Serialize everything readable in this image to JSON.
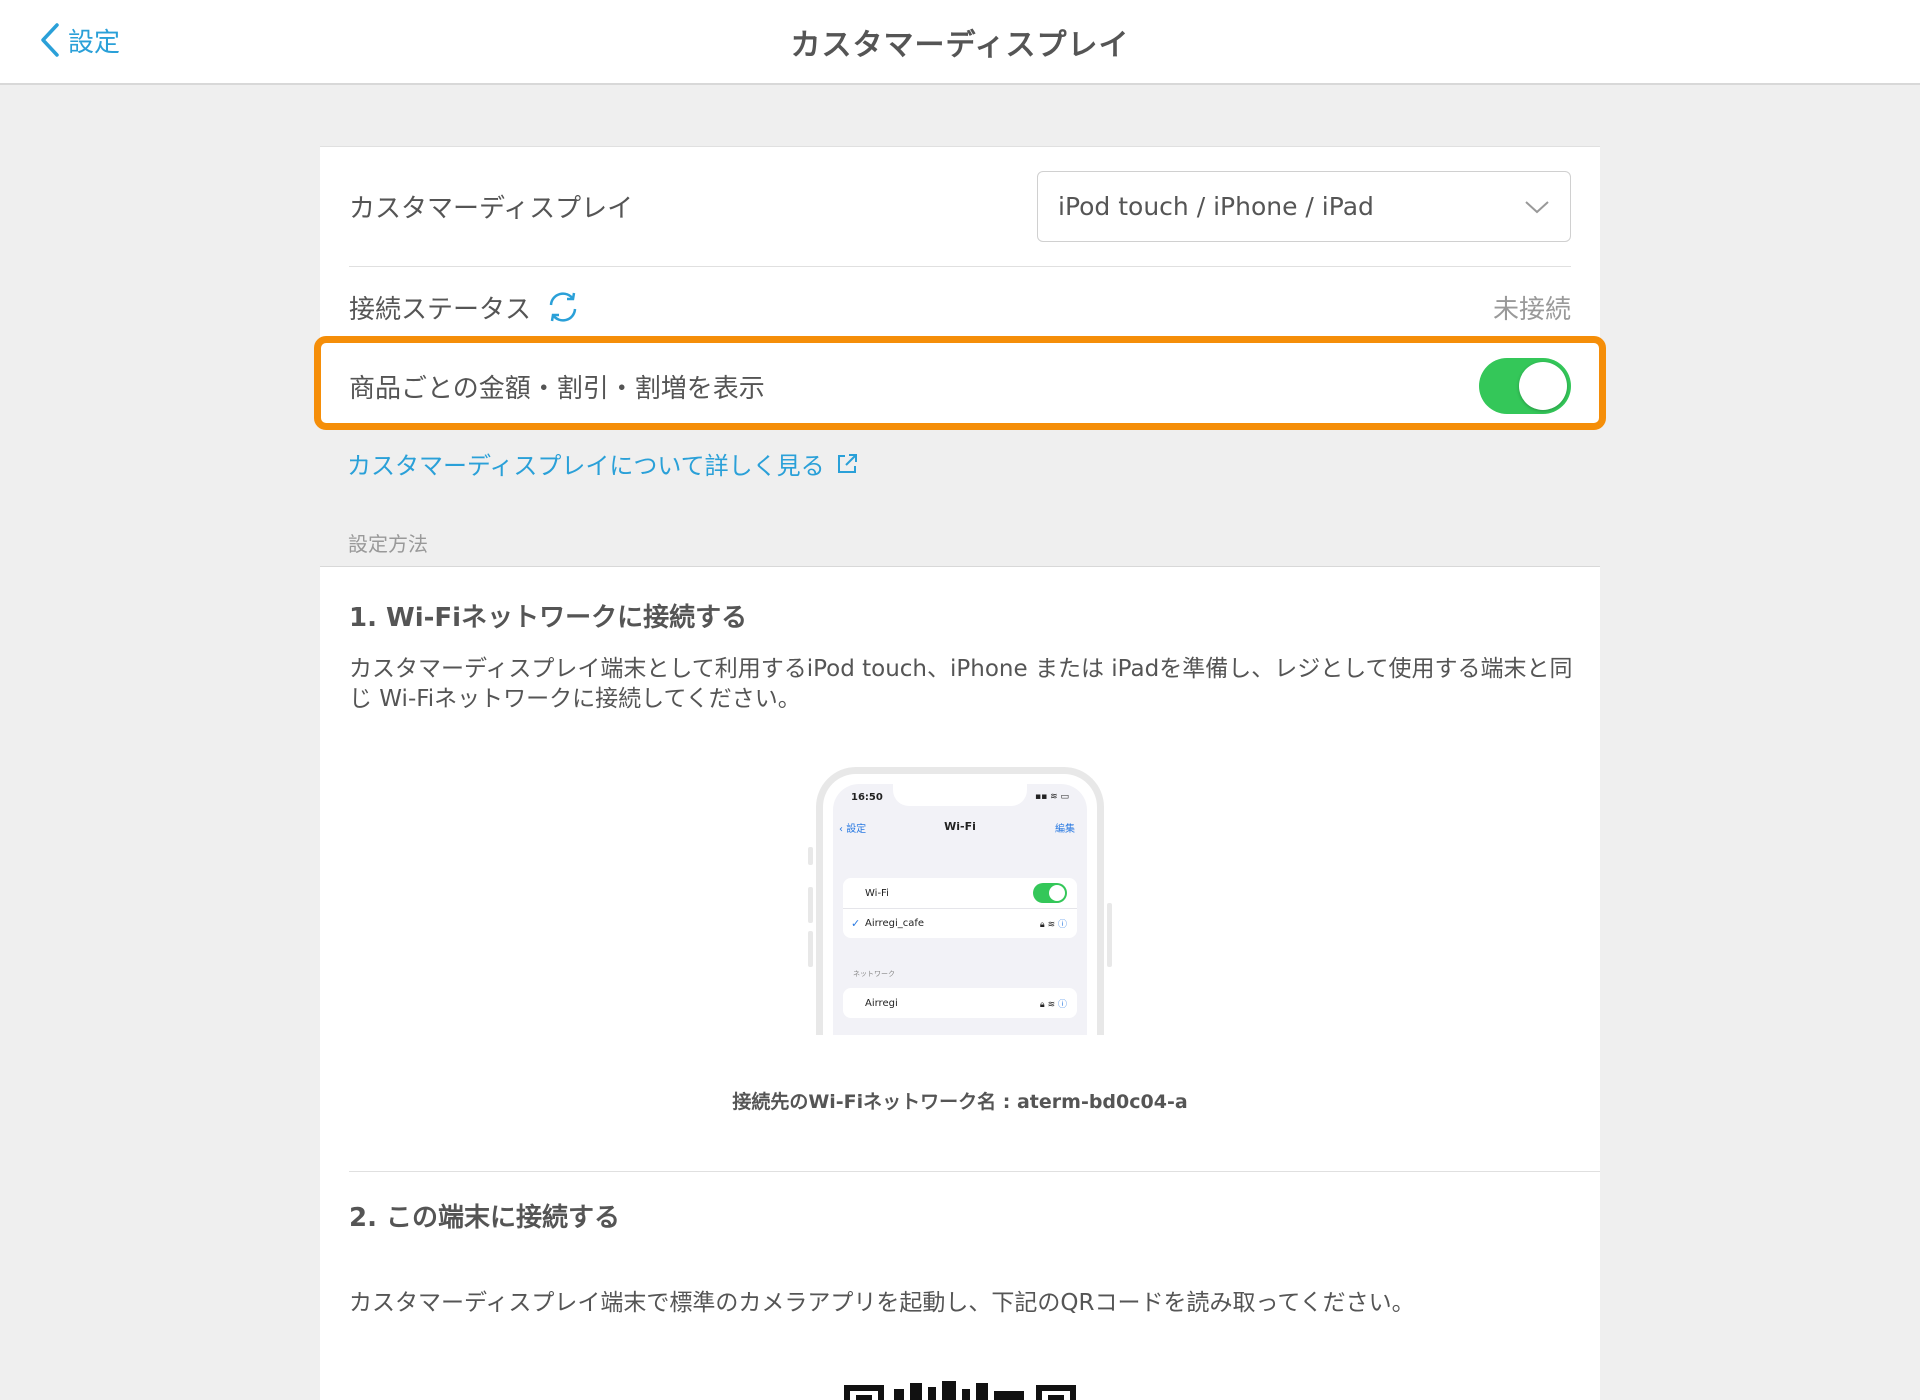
{
  "nav": {
    "back_label": "設定",
    "title": "カスタマーディスプレイ"
  },
  "settings": {
    "display_label": "カスタマーディスプレイ",
    "display_value": "iPod touch / iPhone / iPad",
    "status_label": "接続ステータス",
    "status_value": "未接続",
    "toggle_label": "商品ごとの金額・割引・割増を表示",
    "toggle_on": true,
    "learn_more_link": "カスタマーディスプレイについて詳しく見る"
  },
  "section_label": "設定方法",
  "step1": {
    "title": "1. Wi-Fiネットワークに接続する",
    "description": "カスタマーディスプレイ端末として利用するiPod touch、iPhone または iPadを準備し、レジとして使用する端末と同じ Wi-Fiネットワークに接続してください。",
    "network_caption": "接続先のWi-Fiネットワーク名 : aterm-bd0c04-a"
  },
  "phone_mock": {
    "time": "16:50",
    "back": "設定",
    "title": "Wi-Fi",
    "edit": "編集",
    "wifi_label": "Wi-Fi",
    "connected_network": "Airregi_cafe",
    "networks_header": "ネットワーク",
    "other_network": "Airregi"
  },
  "step2": {
    "title": "2. この端末に接続する",
    "description": "カスタマーディスプレイ端末で標準のカメラアプリを起動し、下記のQRコードを読み取ってください。"
  },
  "colors": {
    "accent": "#2aa0d8",
    "toggle_on": "#34c759",
    "highlight": "#f58e09"
  }
}
